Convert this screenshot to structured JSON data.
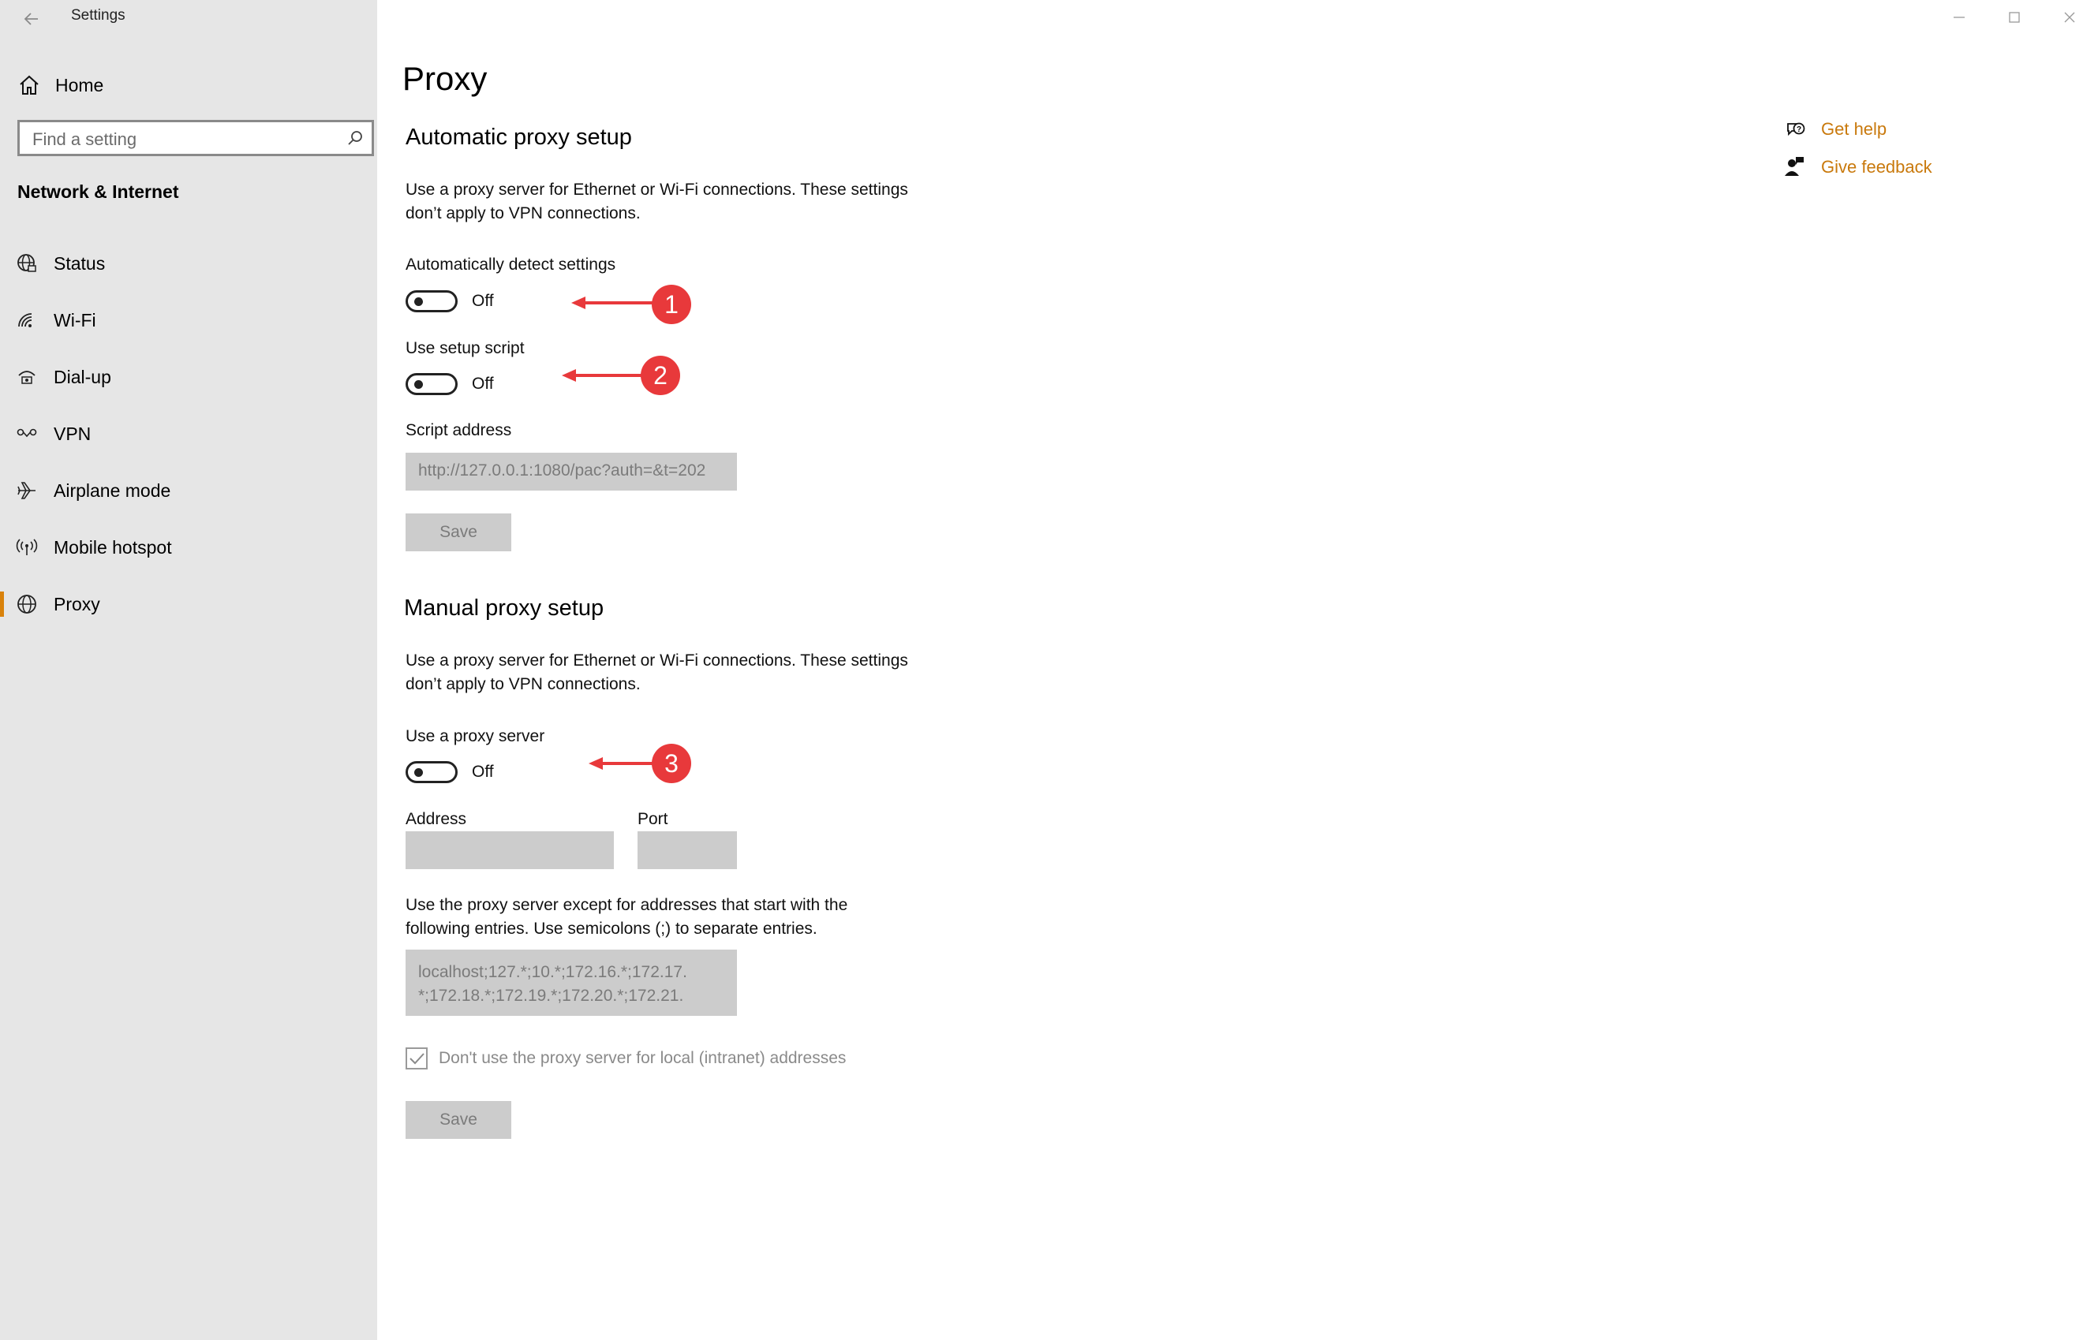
{
  "window": {
    "title": "Settings",
    "minimize_icon": "minimize-icon",
    "maximize_icon": "maximize-icon",
    "close_icon": "close-icon"
  },
  "sidebar": {
    "home_label": "Home",
    "search": {
      "placeholder": "Find a setting"
    },
    "category": "Network & Internet",
    "items": [
      {
        "label": "Status",
        "icon": "globe-status-icon"
      },
      {
        "label": "Wi-Fi",
        "icon": "wifi-icon"
      },
      {
        "label": "Dial-up",
        "icon": "dialup-icon"
      },
      {
        "label": "VPN",
        "icon": "vpn-icon"
      },
      {
        "label": "Airplane mode",
        "icon": "airplane-icon"
      },
      {
        "label": "Mobile hotspot",
        "icon": "hotspot-icon"
      },
      {
        "label": "Proxy",
        "icon": "globe-icon",
        "active": true
      }
    ],
    "accent_color": "#d9820b"
  },
  "main": {
    "title": "Proxy",
    "automatic": {
      "heading": "Automatic proxy setup",
      "description_line1": "Use a proxy server for Ethernet or Wi-Fi connections. These settings",
      "description_line2": "don’t apply to VPN connections.",
      "detect_label": "Automatically detect settings",
      "detect_state": "Off",
      "script_label": "Use setup script",
      "script_state": "Off",
      "address_label": "Script address",
      "address_value": "http://127.0.0.1:1080/pac?auth=&t=202",
      "save_label": "Save"
    },
    "manual": {
      "heading": "Manual proxy setup",
      "description_line1": "Use a proxy server for Ethernet or Wi-Fi connections. These settings",
      "description_line2": "don’t apply to VPN connections.",
      "use_label": "Use a proxy server",
      "use_state": "Off",
      "address_label": "Address",
      "port_label": "Port",
      "exceptions_line1": "Use the proxy server except for addresses that start with the",
      "exceptions_line2": "following entries. Use semicolons (;) to separate entries.",
      "exceptions_value_line1": "localhost;127.*;10.*;172.16.*;172.17.",
      "exceptions_value_line2": "*;172.18.*;172.19.*;172.20.*;172.21.",
      "local_checkbox_label": "Don't use the proxy server for local (intranet) addresses",
      "save_label": "Save"
    },
    "help": {
      "get_help": "Get help",
      "give_feedback": "Give feedback",
      "link_color": "#c9790c"
    }
  },
  "annotations": [
    "1",
    "2",
    "3"
  ],
  "annotation_color": "#e8393b"
}
